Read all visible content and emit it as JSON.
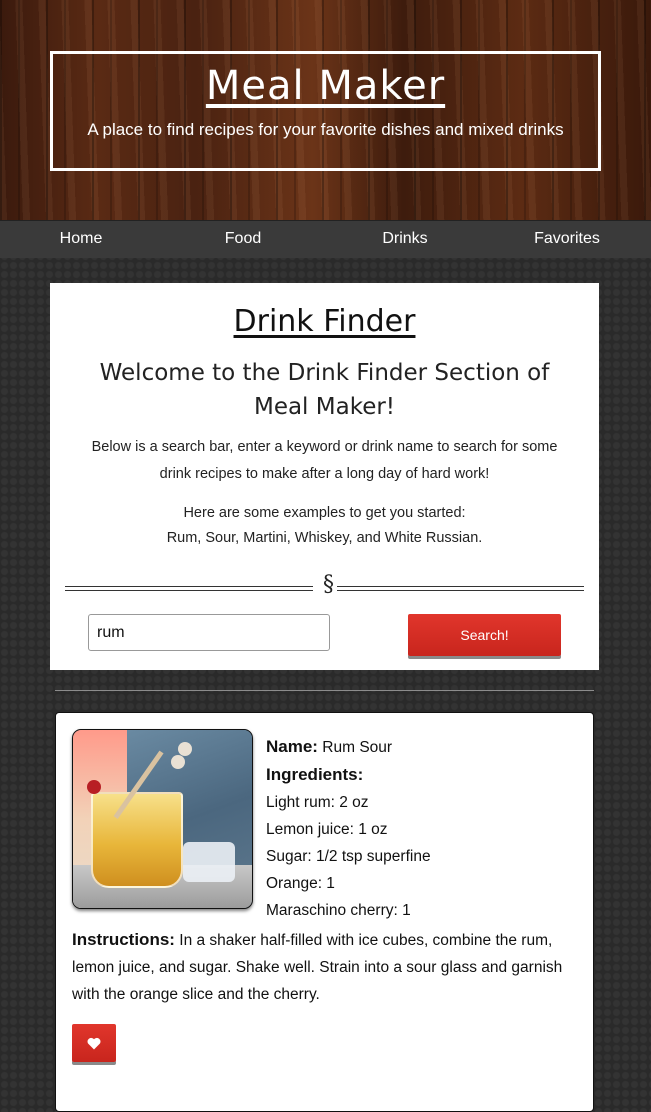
{
  "header": {
    "title": "Meal Maker",
    "tagline": "A place to find recipes for your favorite dishes and mixed drinks"
  },
  "nav": {
    "items": [
      {
        "label": "Home"
      },
      {
        "label": "Food"
      },
      {
        "label": "Drinks"
      },
      {
        "label": "Favorites"
      }
    ]
  },
  "finder": {
    "title": "Drink Finder",
    "welcome": "Welcome to the Drink Finder Section of Meal Maker!",
    "intro": "Below is a search bar, enter a keyword or drink name to search for some drink recipes to make after a long day of hard work!",
    "examples_lead": "Here are some examples to get you started:",
    "examples": "Rum, Sour, Martini, Whiskey, and White Russian.",
    "divider_symbol": "§",
    "search_value": "rum",
    "search_button": "Search!"
  },
  "result": {
    "name_label": "Name:",
    "name": "Rum Sour",
    "ingredients_label": "Ingredients:",
    "ingredients": [
      "Light rum: 2 oz",
      "Lemon juice: 1 oz",
      "Sugar: 1/2 tsp superfine",
      "Orange: 1",
      "Maraschino cherry: 1"
    ],
    "instructions_label": "Instructions:",
    "instructions": "In a shaker half-filled with ice cubes, combine the rum, lemon juice, and sugar. Shake well. Strain into a sour glass and garnish with the orange slice and the cherry.",
    "image_icon": "drink-photo",
    "favorite_icon": "heart-icon"
  },
  "colors": {
    "accent": "#d92b22",
    "nav_bg": "#3a3a3a",
    "page_bg": "#2a2a2a"
  }
}
